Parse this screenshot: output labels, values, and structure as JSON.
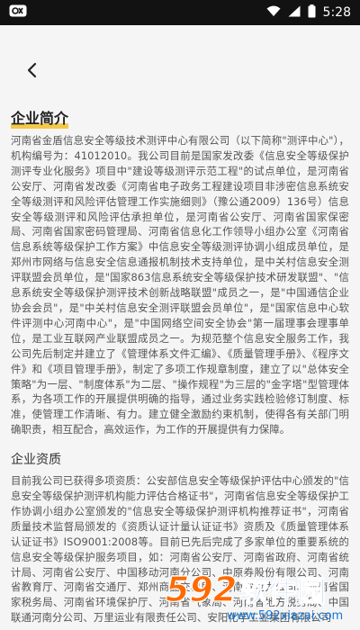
{
  "status_bar": {
    "time": "5:28"
  },
  "icons": {
    "status_left": "cast-icon",
    "wifi": "wifi-icon",
    "signal": "signal-icon",
    "battery": "battery-icon",
    "back": "back-arrow-icon"
  },
  "colors": {
    "accent": "#f2c12e",
    "status_bar": "#121212",
    "background": "#f5f5f5",
    "text": "#555555",
    "watermark_brand": "#1479d6",
    "watermark_num": "#ff6a00"
  },
  "main": {
    "intro_title": "企业简介",
    "intro_text": "河南省金盾信息安全等级技术测评中心有限公司（以下简称\"测评中心\"），机构编号为：41012010。我公司目前是国家发改委《信息安全等级保护测评专业化服务》项目中\"建设等级测评示范工程\"的试点单位，是河南省公安厅、河南省发改委《河南省电子政务工程建设项目非涉密信息系统安全等级测评和风险评估管理工作实施细则》（豫公通2009）136号）信息安全等级测评和风险评估承担单位，是河南省公安厅、河南省国家保密局、河南省国家密码管理局、河南省信息化工作领导小组办公室《河南省信息系统等级保护工作方案》中信息安全等级测评协调小组成员单位，是郑州市网络与信息安全信息通报机制技术支持单位，是中关村信息安全测评联盟会员单位，是\"国家863信息系统安全等级保护技术研发联盟\"、\"信息系统安全等级保护测评技术创新战略联盟\"成员之一，是\"中国通信企业协会会员\"，是\"中关村信息安全测评联盟会员单位\"，是\"国家信息中心软件评测中心河南中心\"，是\"中国网络空间安全协会\"第一届理事会理事单位，是工业互联网产业联盟成员之一。为规范整个信息安全服务工作，我公司先后制定并建立了《管理体系文件汇编》、《质量管理手册》、《程序文件》和《项目管理手册》，制定了多项工作规章制度，建立了以\"总体安全策略\"为一层、\"制度体系\"为二层、\"操作规程\"为三层的\"金字塔\"型管理体系，为各项工作的开展提供明确的指导，通过业务实践检验修订制度、标准，使管理工作清晰、有力。建立健全激励约束机制，使得各有关部门明确职责，相互配合，高效运作，为工作的开展提供有力保障。",
    "qual_title": "企业资质",
    "qual_text": "目前我公司已获得多项资质：公安部信息安全等级保护评估中心颁发的\"信息安全等级保护测评机构能力评估合格证书\"，河南省信息安全等级保护工作协调小组办公室颁发的\"信息安全等级保护测评机构推荐证书\"，河南省质量技术监督局颁发的《资质认证计量认证证书》资质及《质量管理体系认证证书》ISO9001:2008等。目前已先后完成了多家单位的重要系统的信息安全等级保护服务项目，如：河南省公安厅、河南省政府、河南省统计局、河南省公安厅、中国移动河南分公司、中原券股份有限公司、河南省教育厅、河南省交通厅、郑州商品交易所、河南省电力公司、河南省国家税务局、河南省环境保护厅、河南省气象局、河南省地方税务局、中国联通河南分公司、万里运业有限责任公司、安阳化学工业集团有限公司"
  },
  "watermark": {
    "number": "592",
    "brand": "软件园",
    "url": "www.592xiazai.com"
  }
}
